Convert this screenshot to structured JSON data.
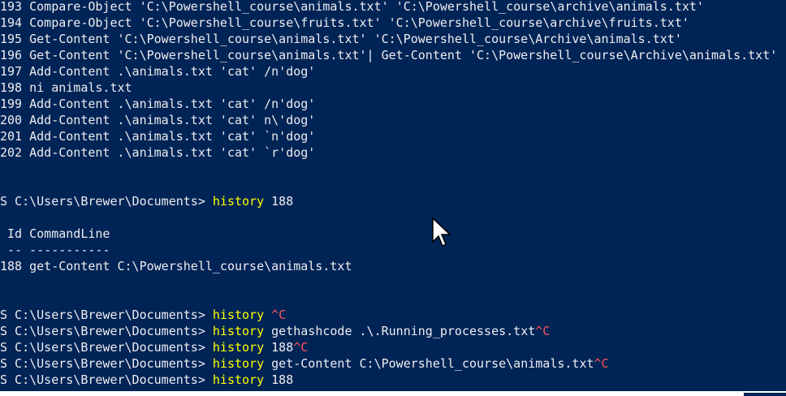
{
  "history_output": [
    {
      "id": "193",
      "text": "Compare-Object 'C:\\Powershell_course\\animals.txt' 'C:\\Powershell_course\\archive\\animals.txt'"
    },
    {
      "id": "194",
      "text": "Compare-Object 'C:\\Powershell_course\\fruits.txt' 'C:\\Powershell_course\\archive\\fruits.txt'"
    },
    {
      "id": "195",
      "text": "Get-Content 'C:\\Powershell_course\\animals.txt' 'C:\\Powershell_course\\Archive\\animals.txt'"
    },
    {
      "id": "196",
      "text": "Get-Content 'C:\\Powershell_course\\animals.txt'| Get-Content 'C:\\Powershell_course\\Archive\\animals.txt'"
    },
    {
      "id": "197",
      "text": "Add-Content .\\animals.txt 'cat' /n'dog'"
    },
    {
      "id": "198",
      "text": "ni animals.txt"
    },
    {
      "id": "199",
      "text": "Add-Content .\\animals.txt 'cat' /n'dog'"
    },
    {
      "id": "200",
      "text": "Add-Content .\\animals.txt 'cat' n\\'dog'"
    },
    {
      "id": "201",
      "text": "Add-Content .\\animals.txt 'cat' `n'dog'"
    },
    {
      "id": "202",
      "text": "Add-Content .\\animals.txt 'cat' `r'dog'"
    }
  ],
  "prompt": "S C:\\Users\\Brewer\\Documents> ",
  "keyword": "history",
  "command1_arg": " 188",
  "table": {
    "header": " Id CommandLine",
    "divider": " -- -----------",
    "row": "188 get-Content C:\\Powershell_course\\animals.txt"
  },
  "commands": [
    {
      "arg": " ",
      "ctrl": "^C"
    },
    {
      "arg": " gethashcode .\\.Running_processes.txt",
      "ctrl": "^C"
    },
    {
      "arg": " 188",
      "ctrl": "^C"
    },
    {
      "arg": " get-Content C:\\Powershell_course\\animals.txt",
      "ctrl": "^C"
    },
    {
      "arg": " 188",
      "ctrl": ""
    }
  ],
  "colors": {
    "background": "#012456",
    "text": "#eeedf0",
    "keyword": "#ffff00",
    "ctrl_c": "#ff5555"
  },
  "icons": {
    "mouse_pointer": "arrow-cursor-icon"
  }
}
